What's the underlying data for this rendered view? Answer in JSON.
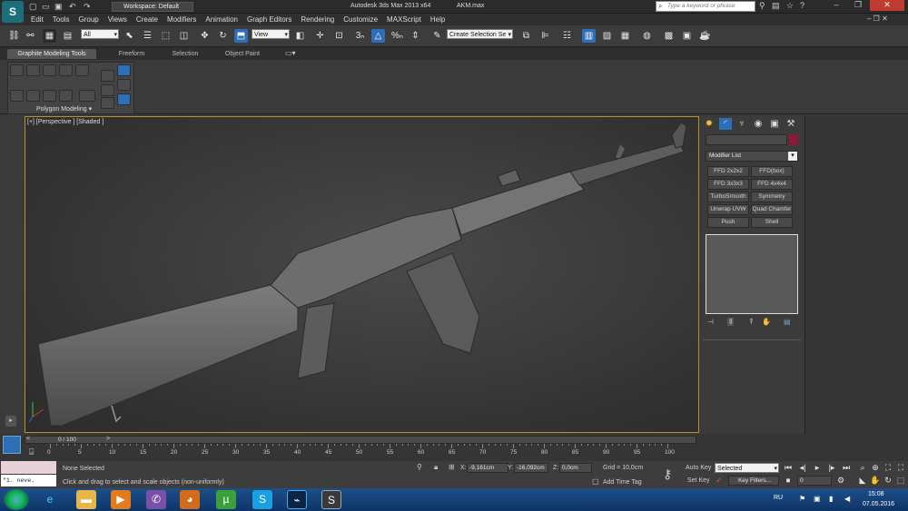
{
  "titlebar": {
    "app_logo": "3ds-max-logo",
    "workspace_label": "Workspace: Default",
    "app_title": "Autodesk 3ds Max  2013 x64",
    "file_name": "AKM.max",
    "search_placeholder": "Type a keyword or phrase"
  },
  "menu": [
    "Edit",
    "Tools",
    "Group",
    "Views",
    "Create",
    "Modifiers",
    "Animation",
    "Graph Editors",
    "Rendering",
    "Customize",
    "MAXScript",
    "Help"
  ],
  "toolbar": {
    "selection_filter": "All",
    "ref_coord": "View",
    "named_selection": "Create Selection Se",
    "snap_label": "3",
    "percent_label": "%"
  },
  "ribbon": {
    "tabs": [
      "Graphite Modeling Tools",
      "Freeform",
      "Selection",
      "Object Paint"
    ],
    "panel_label": "Polygon Modeling"
  },
  "viewport": {
    "label": "[+] [Perspective ] [Shaded ]"
  },
  "command_panel": {
    "modifier_list": "Modifier List",
    "buttons": [
      "FFD 2x2x2",
      "FFD(box)",
      "FFD 3x3x3",
      "FFD 4x4x4",
      "TurboSmooth",
      "Symmetry",
      "Unwrap UVW",
      "Quad Chamfer",
      "Push",
      "Shell"
    ],
    "object_color": "#8b1a3a"
  },
  "timeline": {
    "frame_counter": "0 / 100",
    "ticks": [
      "0",
      "5",
      "10",
      "15",
      "20",
      "25",
      "30",
      "35",
      "40",
      "45",
      "50",
      "55",
      "60",
      "65",
      "70",
      "75",
      "80",
      "85",
      "90",
      "95",
      "100"
    ]
  },
  "status": {
    "maxscript_text": "\"1.    neve.",
    "selection_status": "None Selected",
    "prompt": "Click and drag to select and scale objects (non-uniformly)",
    "x_label": "X:",
    "x_value": "-9,161cm",
    "y_label": "Y:",
    "y_value": "-16,092cm",
    "z_label": "Z:",
    "z_value": "0,0cm",
    "grid": "Grid = 10,0cm",
    "add_time_tag": "Add Time Tag",
    "auto_key": "Auto Key",
    "set_key": "Set Key",
    "selected_dropdown": "Selected",
    "key_filters": "Key Filters...",
    "frame_field": "0"
  },
  "taskbar": {
    "language": "RU",
    "time": "15:08",
    "date": "07.05.2016"
  }
}
